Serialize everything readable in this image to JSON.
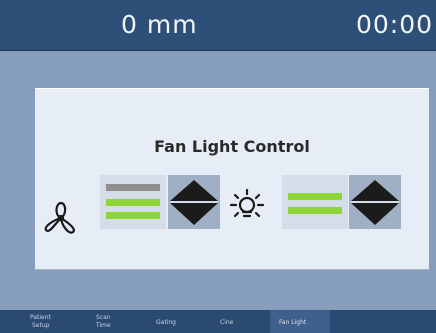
{
  "header": {
    "position": "0 mm",
    "time": "00:00"
  },
  "panel": {
    "title": "Fan Light Control"
  },
  "controls": {
    "fan": {
      "icon": "fan-icon",
      "levels_total": 3,
      "levels_on": 2
    },
    "light": {
      "icon": "light-bulb-icon",
      "levels_total": 2,
      "levels_on": 2
    }
  },
  "tabs": [
    {
      "label_line1": "Patient",
      "label_line2": "Setup"
    },
    {
      "label_line1": "Scan",
      "label_line2": "Time"
    },
    {
      "label_line1": "Gating",
      "label_line2": ""
    },
    {
      "label_line1": "Cine",
      "label_line2": ""
    },
    {
      "label_line1": "Fan Light",
      "label_line2": ""
    }
  ],
  "active_tab": "Fan Light",
  "colors": {
    "header": "#2e4f78",
    "background": "#869dbb",
    "panel": "#e6edf6",
    "level_on": "#8ed53a",
    "level_off": "#8e8e8e",
    "stepper": "#9fb0c5"
  }
}
